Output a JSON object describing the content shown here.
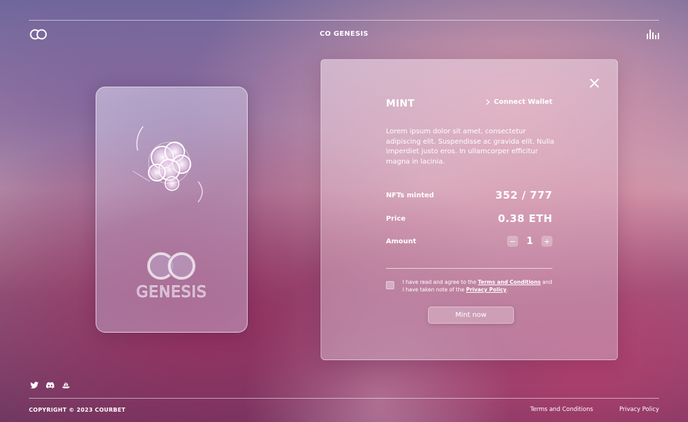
{
  "header": {
    "logo_text": "CO",
    "title": "CO GENESIS"
  },
  "card": {
    "logo_text": "CO",
    "wordmark": "GENESIS"
  },
  "mint": {
    "heading": "MINT",
    "connect_label": "Connect Wallet",
    "description": "Lorem ipsum dolor sit amet, consectetur adipiscing elit. Suspendisse ac gravida elit. Nulla imperdiet justo eros. In ullamcorper efficitur magna in lacinia.",
    "nfts_minted_label": "NFTs minted",
    "nfts_minted_value": "352 / 777",
    "price_label": "Price",
    "price_value": "0.38 ETH",
    "amount_label": "Amount",
    "amount_value": "1",
    "decrement": "−",
    "increment": "+",
    "agree_prefix": "I have read and agree to the ",
    "agree_terms": "Terms and Conditions",
    "agree_middle": " and I have taken note of the ",
    "agree_privacy": "Privacy Policy",
    "agree_suffix": ".",
    "button_label": "Mint now"
  },
  "footer": {
    "copyright": "COPYRIGHT © 2023 COURBET",
    "terms": "Terms and Conditions",
    "privacy": "Privacy Policy",
    "socials": [
      "twitter-icon",
      "discord-icon",
      "opensea-icon"
    ]
  }
}
